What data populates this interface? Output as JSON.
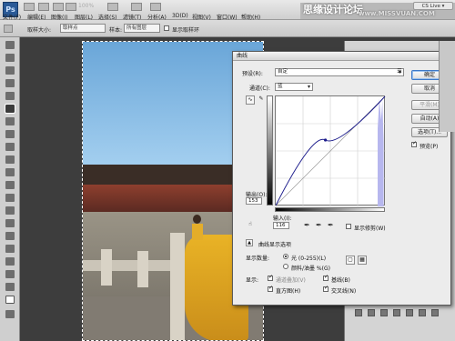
{
  "app": {
    "logo": "Ps",
    "zoom": "100%"
  },
  "menu": [
    "文件(F)",
    "编辑(E)",
    "图像(I)",
    "图层(L)",
    "选择(S)",
    "滤镜(T)",
    "分析(A)",
    "3D(D)",
    "视图(V)",
    "窗口(W)",
    "帮助(H)"
  ],
  "watermark": {
    "cn": "思缘设计论坛",
    "url": "www.MISSVUAN.COM"
  },
  "cslive": "CS Live ▾",
  "options": {
    "sample_size_label": "取样大小:",
    "sample_size_value": "取样点",
    "sample_label": "样本:",
    "sample_value": "所有图层",
    "show_ring_label": "显示取样环"
  },
  "dialog": {
    "title": "曲线",
    "preset_label": "预设(R):",
    "preset_value": "自定",
    "channel_label": "通道(C):",
    "channel_value": "蓝",
    "output_label": "输出(O):",
    "output_value": "153",
    "input_label": "输入(I):",
    "input_value": "116",
    "show_clipping_label": "显示修剪(W)",
    "curve_options_label": "曲线显示选项",
    "display_amount_label": "显示数量:",
    "light_option": "光 (0-255)(L)",
    "pigment_option": "颜料/油墨 %(G)",
    "show_label": "显示:",
    "channel_overlay": "通道叠加(V)",
    "baseline": "基线(B)",
    "histogram": "直方图(H)",
    "intersection": "交叉线(N)",
    "buttons": {
      "ok": "确定",
      "cancel": "取消",
      "smooth": "平滑(M)",
      "auto": "自动(A)",
      "options": "选项(T)...",
      "preview": "预览(P)"
    },
    "curve": {
      "points": [
        [
          0,
          0
        ],
        [
          116,
          153
        ],
        [
          255,
          255
        ]
      ],
      "baseline_color": "#9a9a9a",
      "curve_color": "#1c1c8c",
      "histogram_color": "#b7b7ee"
    }
  }
}
